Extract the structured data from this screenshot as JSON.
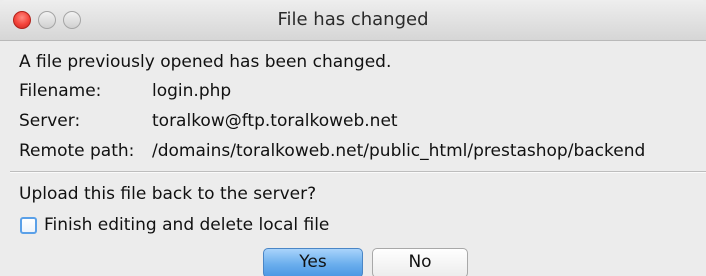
{
  "window": {
    "title": "File has changed"
  },
  "message": "A file previously opened has been changed.",
  "details": [
    {
      "label": "Filename:",
      "value": "login.php"
    },
    {
      "label": "Server:",
      "value": "toralkow@ftp.toralkoweb.net"
    },
    {
      "label": "Remote path:",
      "value": "/domains/toralkoweb.net/public_html/prestashop/backend"
    }
  ],
  "question": "Upload this file back to the server?",
  "options": {
    "finish_editing_label": "Finish editing and delete local file",
    "finish_editing_checked": false
  },
  "buttons": {
    "yes": "Yes",
    "no": "No"
  },
  "colors": {
    "close_button": "#f4433a",
    "default_button": "#6aaeed",
    "checkbox_border": "#5aa0e8"
  }
}
